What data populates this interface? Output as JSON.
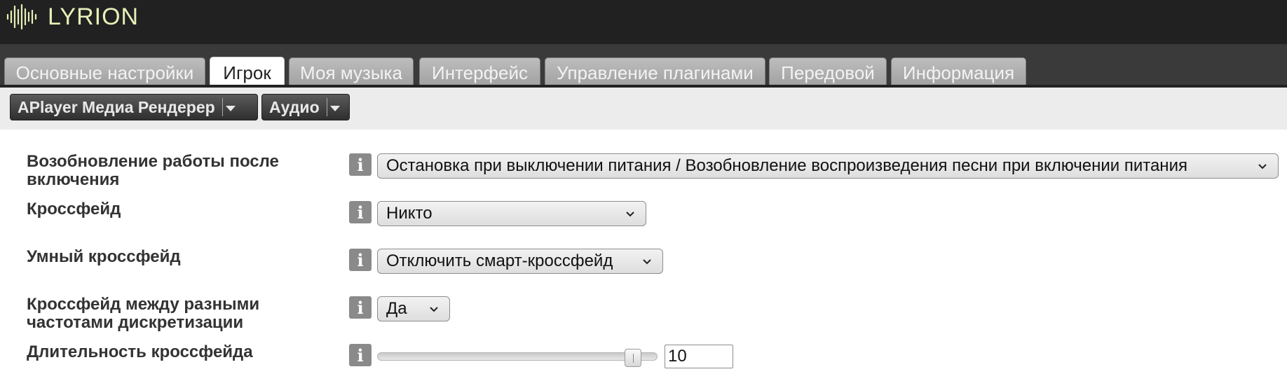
{
  "app": {
    "name": "LYRION",
    "logo_color": "#e6efb8"
  },
  "tabs": [
    {
      "label": "Основные настройки",
      "active": false
    },
    {
      "label": "Игрок",
      "active": true
    },
    {
      "label": "Моя музыка",
      "active": false
    },
    {
      "label": "Интерфейс",
      "active": false
    },
    {
      "label": "Управление плагинами",
      "active": false
    },
    {
      "label": "Передовой",
      "active": false
    },
    {
      "label": "Информация",
      "active": false
    }
  ],
  "player_menu": {
    "label": "APlayer Медиа Рендерер"
  },
  "section_menu": {
    "label": "Аудио"
  },
  "settings": {
    "power_on_resume": {
      "label_line1": "Возобновление работы после",
      "label_line2": "включения",
      "value": "Остановка при выключении питания / Возобновление воспроизведения песни при включении питания"
    },
    "crossfade": {
      "label": "Кроссфейд",
      "value": "Никто"
    },
    "smart_crossfade": {
      "label": "Умный кроссфейд",
      "value": "Отключить смарт-кроссфейд"
    },
    "crossfade_samplerate": {
      "label_line1": "Кроссфейд между разными",
      "label_line2": "частотами дискретизации",
      "value": "Да"
    },
    "crossfade_duration": {
      "label": "Длительность кроссфейда",
      "value": "10",
      "slider_fraction": 0.94
    }
  },
  "info_icon": "info-icon",
  "colors": {
    "header_bg": "#212121",
    "tab_bg": "#a9a9a9",
    "active_tab_bg": "#ffffff"
  }
}
